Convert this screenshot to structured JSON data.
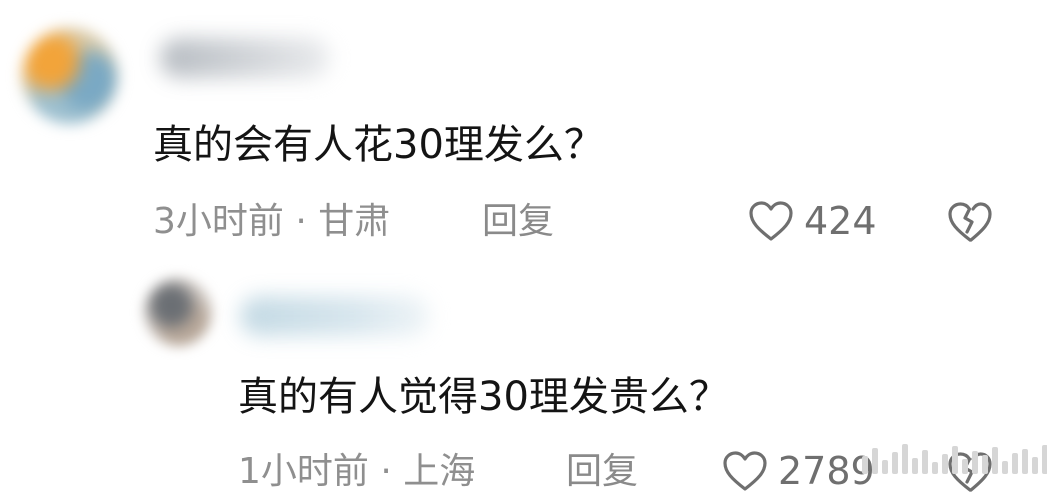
{
  "comments": [
    {
      "text": "真的会有人花30理发么？",
      "time_location": "3小时前 · 甘肃",
      "reply_label": "回复",
      "like_count": "424"
    },
    {
      "text": "真的有人觉得30理发贵么？",
      "time_location": "1小时前 · 上海",
      "reply_label": "回复",
      "like_count": "2789"
    }
  ],
  "icons": {
    "like": "heart-outline-icon",
    "dislike": "broken-heart-icon"
  },
  "colors": {
    "text": "#141414",
    "meta": "#8f8f8f",
    "icon": "#6f6f6f",
    "background": "#ffffff"
  }
}
